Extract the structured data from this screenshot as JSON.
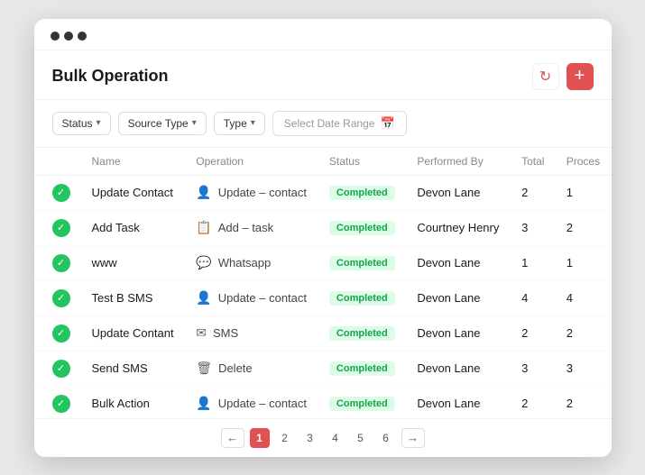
{
  "window": {
    "dots": [
      "dot1",
      "dot2",
      "dot3"
    ]
  },
  "header": {
    "title": "Bulk Operation",
    "refresh_label": "↻",
    "add_label": "+"
  },
  "filters": [
    {
      "id": "status",
      "label": "Status"
    },
    {
      "id": "source-type",
      "label": "Source Type"
    },
    {
      "id": "type",
      "label": "Type"
    }
  ],
  "date_filter": {
    "placeholder": "Select Date Range"
  },
  "table": {
    "columns": [
      {
        "id": "check",
        "label": ""
      },
      {
        "id": "name",
        "label": "Name"
      },
      {
        "id": "operation",
        "label": "Operation"
      },
      {
        "id": "status",
        "label": "Status"
      },
      {
        "id": "performed_by",
        "label": "Performed By"
      },
      {
        "id": "total",
        "label": "Total"
      },
      {
        "id": "process",
        "label": "Proces"
      }
    ],
    "rows": [
      {
        "name": "Update Contact",
        "operation": "Update – contact",
        "op_icon": "person",
        "status": "Completed",
        "performed_by": "Devon Lane",
        "total": "2",
        "process": "1"
      },
      {
        "name": "Add Task",
        "operation": "Add – task",
        "op_icon": "clipboard",
        "status": "Completed",
        "performed_by": "Courtney Henry",
        "total": "3",
        "process": "2"
      },
      {
        "name": "www",
        "operation": "Whatsapp",
        "op_icon": "chat",
        "status": "Completed",
        "performed_by": "Devon Lane",
        "total": "1",
        "process": "1"
      },
      {
        "name": "Test B SMS",
        "operation": "Update – contact",
        "op_icon": "person",
        "status": "Completed",
        "performed_by": "Devon Lane",
        "total": "4",
        "process": "4"
      },
      {
        "name": "Update Contant",
        "operation": "SMS",
        "op_icon": "sms",
        "status": "Completed",
        "performed_by": "Devon Lane",
        "total": "2",
        "process": "2"
      },
      {
        "name": "Send SMS",
        "operation": "Delete",
        "op_icon": "trash",
        "status": "Completed",
        "performed_by": "Devon Lane",
        "total": "3",
        "process": "3"
      },
      {
        "name": "Bulk Action",
        "operation": "Update – contact",
        "op_icon": "person",
        "status": "Completed",
        "performed_by": "Devon Lane",
        "total": "2",
        "process": "2"
      }
    ]
  },
  "pagination": {
    "pages": [
      "1",
      "2",
      "3",
      "4",
      "5",
      "6"
    ],
    "active_page": "1",
    "prev_label": "←",
    "next_label": "→"
  },
  "icons": {
    "person": "👤",
    "clipboard": "📋",
    "chat": "💬",
    "sms": "✉",
    "trash": "🗑",
    "calendar": "📅"
  }
}
